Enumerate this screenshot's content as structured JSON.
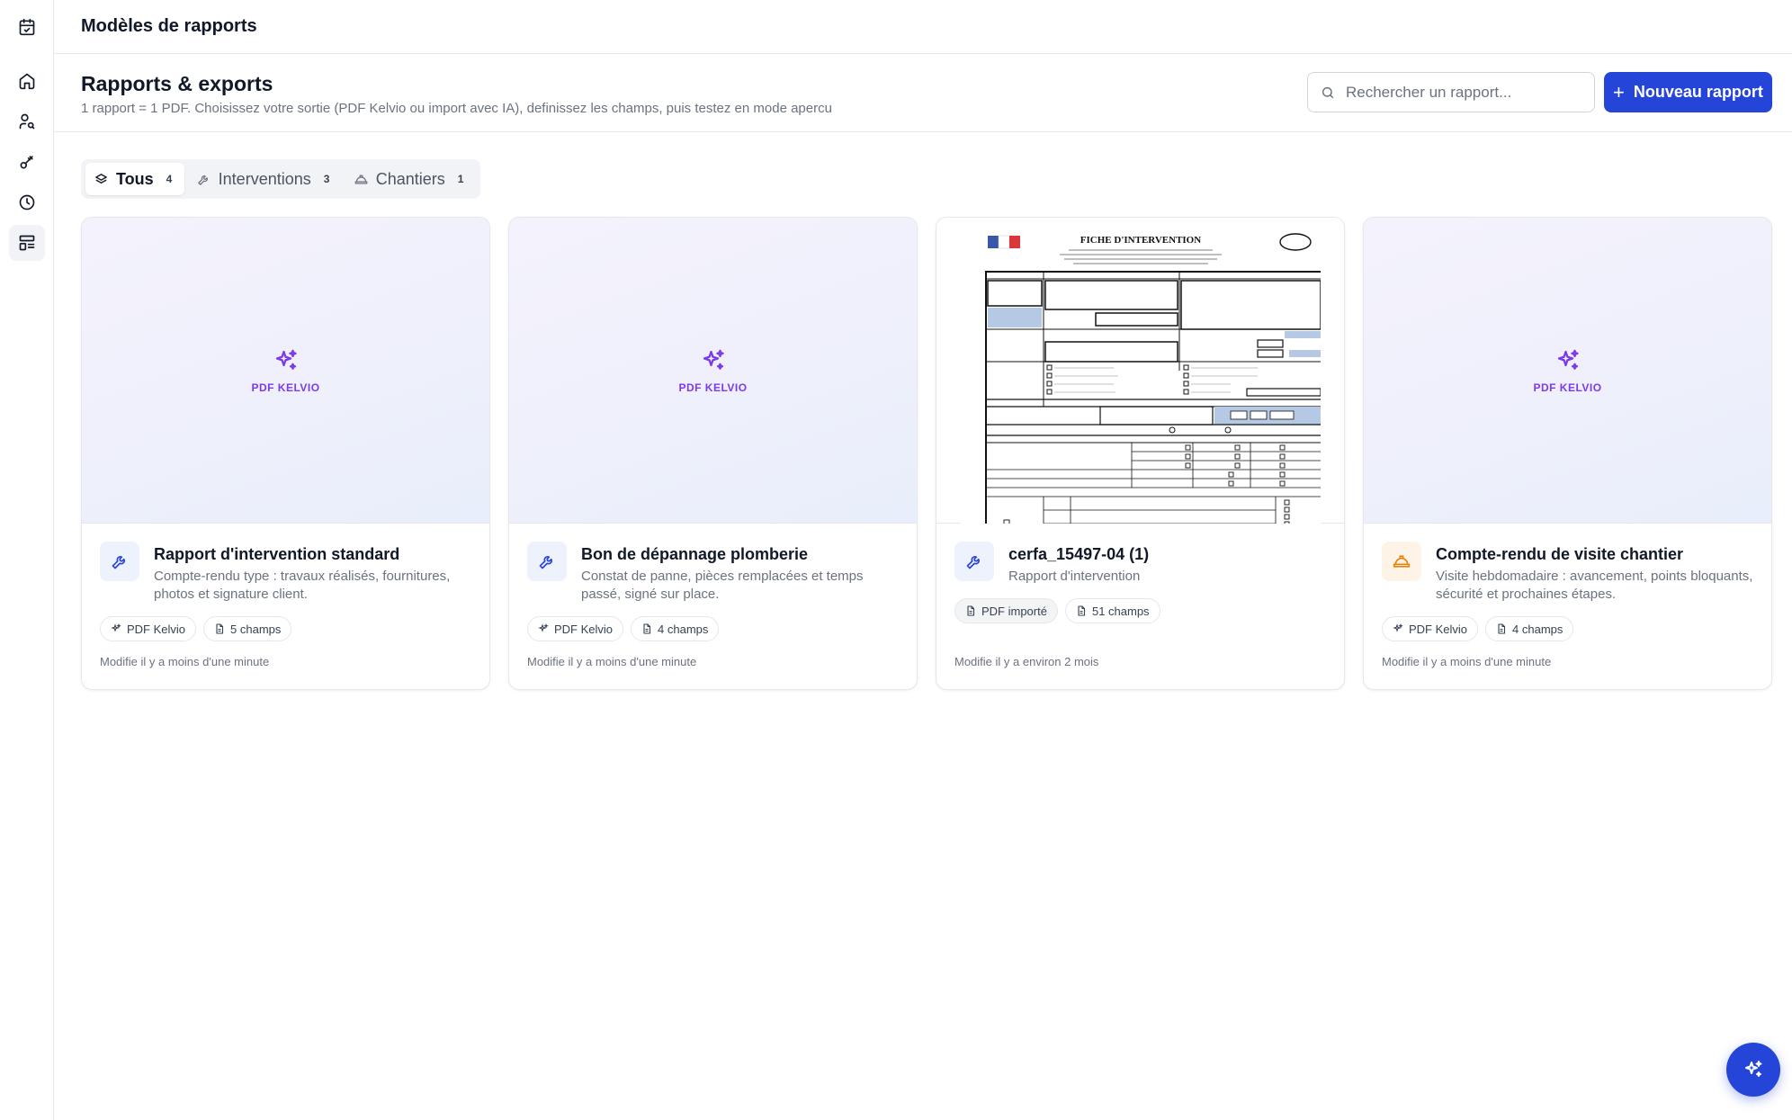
{
  "header": {
    "title": "Modèles de rapports"
  },
  "page": {
    "title": "Rapports & exports",
    "subtitle": "1 rapport = 1 PDF. Choisissez votre sortie (PDF Kelvio ou import avec IA), definissez les champs, puis testez en mode apercu",
    "search_placeholder": "Rechercher un rapport...",
    "new_button": "Nouveau rapport"
  },
  "tabs": [
    {
      "label": "Tous",
      "count": "4",
      "icon": "layers-icon"
    },
    {
      "label": "Interventions",
      "count": "3",
      "icon": "wrench-icon"
    },
    {
      "label": "Chantiers",
      "count": "1",
      "icon": "hard-hat-icon"
    }
  ],
  "cards": [
    {
      "preview_label": "PDF KELVIO",
      "title": "Rapport d'intervention standard",
      "description": "Compte-rendu type : travaux réalisés, fournitures, photos et signature client.",
      "chips": [
        "PDF Kelvio",
        "5 champs"
      ],
      "modified": "Modifie il y a moins d'une minute",
      "icon": "wrench-icon"
    },
    {
      "preview_label": "PDF KELVIO",
      "title": "Bon de dépannage plomberie",
      "description": "Constat de panne, pièces remplacées et temps passé, signé sur place.",
      "chips": [
        "PDF Kelvio",
        "4 champs"
      ],
      "modified": "Modifie il y a moins d'une minute",
      "icon": "wrench-icon"
    },
    {
      "preview_doc_title": "FICHE D'INTERVENTION",
      "title": "cerfa_15497-04 (1)",
      "description": "Rapport d'intervention",
      "chips": [
        "PDF importé",
        "51 champs"
      ],
      "modified": "Modifie il y a environ 2 mois",
      "icon": "wrench-icon"
    },
    {
      "preview_label": "PDF KELVIO",
      "title": "Compte-rendu de visite chantier",
      "description": "Visite hebdomadaire : avancement, points bloquants, sécurité et prochaines étapes.",
      "chips": [
        "PDF Kelvio",
        "4 champs"
      ],
      "modified": "Modifie il y a moins d'une minute",
      "icon": "hard-hat-icon"
    }
  ],
  "colors": {
    "accent": "#2545d9",
    "kelvio_purple": "#7c3aed",
    "chantier_orange": "#e8830c"
  }
}
